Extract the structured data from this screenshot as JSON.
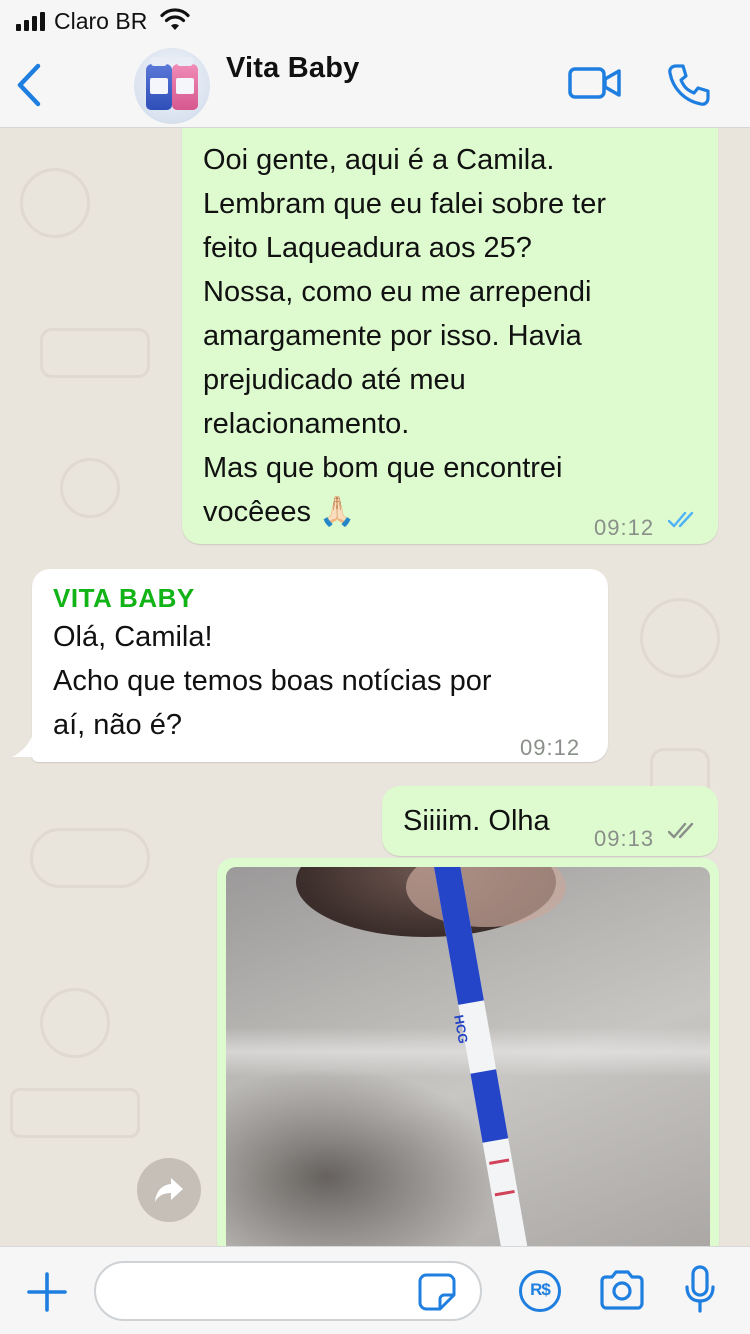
{
  "status_bar": {
    "carrier": "Claro BR",
    "signal_bars": 4
  },
  "header": {
    "contact_name": "Vita Baby"
  },
  "messages": [
    {
      "direction": "outgoing",
      "lines": [
        "Ooi gente, aqui é a Camila.",
        "Lembram que eu falei sobre ter",
        "feito Laqueadura aos  25?",
        "Nossa, como eu me arrependi",
        "amargamente por isso. Havia",
        "prejudicado até meu",
        "relacionamento.",
        "Mas que bom que encontrei",
        "vocêees 🙏🏻"
      ],
      "time": "09:12",
      "status": "read"
    },
    {
      "direction": "incoming",
      "sender": "VITA BABY",
      "lines": [
        "Olá, Camila!",
        "Acho que temos boas notícias por",
        "aí, não é?"
      ],
      "time": "09:12"
    },
    {
      "direction": "outgoing",
      "text": "Siiiim. Olha",
      "time": "09:13",
      "status": "delivered"
    },
    {
      "direction": "outgoing",
      "type": "image",
      "image_text": "HCG"
    }
  ],
  "input_bar": {
    "message_value": "",
    "payment_label": "R$"
  },
  "colors": {
    "accent_blue": "#1f7fe0",
    "outgoing_bubble": "#ddfbcf",
    "incoming_bubble": "#ffffff",
    "sender_name": "#12b316",
    "read_ticks": "#4fb3f6",
    "delivered_ticks": "#8a8f89"
  },
  "icons": [
    "wifi-icon",
    "back-icon",
    "video-call-icon",
    "phone-icon",
    "double-check-icon",
    "forward-icon",
    "plus-icon",
    "sticker-icon",
    "payment-icon",
    "camera-icon",
    "mic-icon"
  ]
}
